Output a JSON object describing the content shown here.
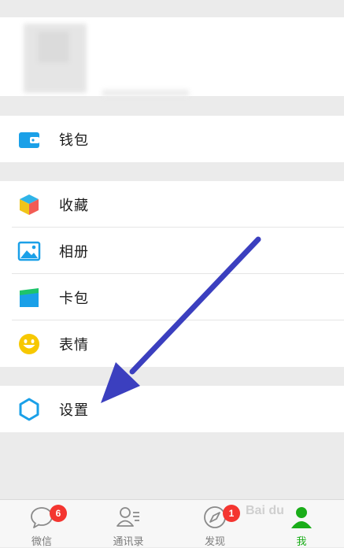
{
  "menu": {
    "wallet": {
      "label": "钱包",
      "icon": "wallet-icon"
    },
    "favorites": {
      "label": "收藏",
      "icon": "cube-icon"
    },
    "album": {
      "label": "相册",
      "icon": "picture-icon"
    },
    "cards": {
      "label": "卡包",
      "icon": "card-icon"
    },
    "stickers": {
      "label": "表情",
      "icon": "smiley-icon"
    },
    "settings": {
      "label": "设置",
      "icon": "gear-icon"
    }
  },
  "tabbar": {
    "tabs": [
      {
        "label": "微信",
        "icon": "chat-icon",
        "badge": "6"
      },
      {
        "label": "通讯录",
        "icon": "contacts-icon"
      },
      {
        "label": "发现",
        "icon": "compass-icon",
        "badge": "1"
      },
      {
        "label": "我",
        "icon": "person-icon",
        "active": true
      }
    ]
  },
  "watermark": "Bai du",
  "colors": {
    "accent": "#1aad19",
    "badge": "#f43530",
    "arrow": "#3b3fbf",
    "icon_blue": "#1aa0e8"
  }
}
